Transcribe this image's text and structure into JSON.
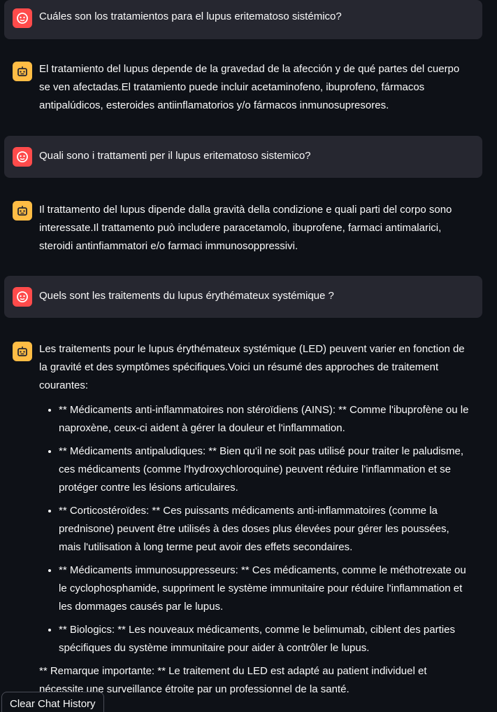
{
  "conversation": [
    {
      "role": "user",
      "avatar_icon": "user-face-icon",
      "text": "Cuáles son los tratamientos para el lupus eritematoso sistémico?"
    },
    {
      "role": "assistant",
      "avatar_icon": "robot-icon",
      "text": "El tratamiento del lupus depende de la gravedad de la afección y de qué partes del cuerpo se ven afectadas.El tratamiento puede incluir acetaminofeno, ibuprofeno, fármacos antipalúdicos, esteroides antiinflamatorios y/o fármacos inmunosupresores."
    },
    {
      "role": "user",
      "avatar_icon": "user-face-icon",
      "text": "Quali sono i trattamenti per il lupus eritematoso sistemico?"
    },
    {
      "role": "assistant",
      "avatar_icon": "robot-icon",
      "text": "Il trattamento del lupus dipende dalla gravità della condizione e quali parti del corpo sono interessate.Il trattamento può includere paracetamolo, ibuprofene, farmaci antimalarici, steroidi antinfiammatori e/o farmaci immunosoppressivi."
    },
    {
      "role": "user",
      "avatar_icon": "user-face-icon",
      "text": "Quels sont les traitements du lupus érythémateux systémique ?"
    },
    {
      "role": "assistant",
      "avatar_icon": "robot-icon",
      "intro": "Les traitements pour le lupus érythémateux systémique (LED) peuvent varier en fonction de la gravité et des symptômes spécifiques.Voici un résumé des approches de traitement courantes:",
      "points": [
        "** Médicaments anti-inflammatoires non stéroïdiens (AINS): ** Comme l'ibuprofène ou le naproxène, ceux-ci aident à gérer la douleur et l'inflammation.",
        "** Médicaments antipaludiques: ** Bien qu'il ne soit pas utilisé pour traiter le paludisme, ces médicaments (comme l'hydroxychloroquine) peuvent réduire l'inflammation et se protéger contre les lésions articulaires.",
        "** Corticostéroïdes: ** Ces puissants médicaments anti-inflammatoires (comme la prednisone) peuvent être utilisés à des doses plus élevées pour gérer les poussées, mais l'utilisation à long terme peut avoir des effets secondaires.",
        "** Médicaments immunosuppresseurs: ** Ces médicaments, comme le méthotrexate ou le cyclophosphamide, suppriment le système immunitaire pour réduire l'inflammation et les dommages causés par le lupus.",
        "** Biologics: ** Les nouveaux médicaments, comme le belimumab, ciblent des parties spécifiques du système immunitaire pour aider à contrôler le lupus."
      ],
      "note": "** Remarque importante: ** Le traitement du LED est adapté au patient individuel et nécessite une surveillance étroite par un professionnel de la santé."
    }
  ],
  "clear_button": {
    "label": "Clear Chat History"
  },
  "colors": {
    "background": "#0e1117",
    "user_bubble": "#262730",
    "user_avatar": "#ff4b4b",
    "assistant_avatar": "#ffbd45",
    "text": "#fafafa"
  }
}
